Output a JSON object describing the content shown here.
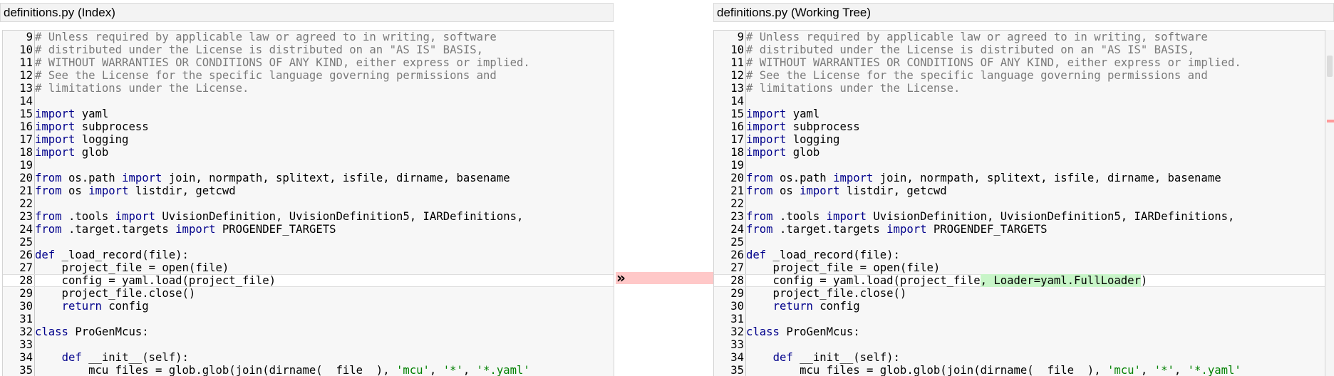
{
  "left_pane": {
    "title": "definitions.py (Index)",
    "lines": [
      {
        "n": "9",
        "s": [
          [
            "cm",
            "# Unless required by applicable law or agreed to in writing, software"
          ]
        ]
      },
      {
        "n": "10",
        "s": [
          [
            "cm",
            "# distributed under the License is distributed on an \"AS IS\" BASIS,"
          ]
        ]
      },
      {
        "n": "11",
        "s": [
          [
            "cm",
            "# WITHOUT WARRANTIES OR CONDITIONS OF ANY KIND, either express or implied."
          ]
        ]
      },
      {
        "n": "12",
        "s": [
          [
            "cm",
            "# See the License for the specific language governing permissions and"
          ]
        ]
      },
      {
        "n": "13",
        "s": [
          [
            "cm",
            "# limitations under the License."
          ]
        ]
      },
      {
        "n": "14",
        "s": []
      },
      {
        "n": "15",
        "s": [
          [
            "kw",
            "import"
          ],
          [
            "p",
            " yaml"
          ]
        ]
      },
      {
        "n": "16",
        "s": [
          [
            "kw",
            "import"
          ],
          [
            "p",
            " subprocess"
          ]
        ]
      },
      {
        "n": "17",
        "s": [
          [
            "kw",
            "import"
          ],
          [
            "p",
            " logging"
          ]
        ]
      },
      {
        "n": "18",
        "s": [
          [
            "kw",
            "import"
          ],
          [
            "p",
            " glob"
          ]
        ]
      },
      {
        "n": "19",
        "s": []
      },
      {
        "n": "20",
        "s": [
          [
            "kw",
            "from"
          ],
          [
            "p",
            " os.path "
          ],
          [
            "kw",
            "import"
          ],
          [
            "p",
            " join, normpath, splitext, isfile, dirname, basename"
          ]
        ]
      },
      {
        "n": "21",
        "s": [
          [
            "kw",
            "from"
          ],
          [
            "p",
            " os "
          ],
          [
            "kw",
            "import"
          ],
          [
            "p",
            " listdir, getcwd"
          ]
        ]
      },
      {
        "n": "22",
        "s": []
      },
      {
        "n": "23",
        "s": [
          [
            "kw",
            "from"
          ],
          [
            "p",
            " .tools "
          ],
          [
            "kw",
            "import"
          ],
          [
            "p",
            " UvisionDefinition, UvisionDefinition5, IARDefinitions,"
          ]
        ]
      },
      {
        "n": "24",
        "s": [
          [
            "kw",
            "from"
          ],
          [
            "p",
            " .target.targets "
          ],
          [
            "kw",
            "import"
          ],
          [
            "p",
            " PROGENDEF_TARGETS"
          ]
        ]
      },
      {
        "n": "25",
        "s": []
      },
      {
        "n": "26",
        "s": [
          [
            "kw",
            "def"
          ],
          [
            "p",
            " _load_record(file):"
          ]
        ]
      },
      {
        "n": "27",
        "s": [
          [
            "p",
            "    project_file = open(file)"
          ]
        ]
      },
      {
        "n": "28",
        "changed": true,
        "s": [
          [
            "p",
            "    config = yaml.load(project_file)"
          ]
        ]
      },
      {
        "n": "29",
        "s": [
          [
            "p",
            "    project_file.close()"
          ]
        ]
      },
      {
        "n": "30",
        "s": [
          [
            "p",
            "    "
          ],
          [
            "kw",
            "return"
          ],
          [
            "p",
            " config"
          ]
        ]
      },
      {
        "n": "31",
        "s": []
      },
      {
        "n": "32",
        "s": [
          [
            "kw",
            "class"
          ],
          [
            "p",
            " ProGenMcus:"
          ]
        ]
      },
      {
        "n": "33",
        "s": []
      },
      {
        "n": "34",
        "s": [
          [
            "p",
            "    "
          ],
          [
            "kw",
            "def"
          ],
          [
            "p",
            " __init__(self):"
          ]
        ]
      },
      {
        "n": "35",
        "s": [
          [
            "p",
            "        mcu_files = glob.glob(join(dirname(__file__), "
          ],
          [
            "str",
            "'mcu'"
          ],
          [
            "p",
            ", "
          ],
          [
            "str",
            "'*'"
          ],
          [
            "p",
            ", "
          ],
          [
            "str",
            "'*.yaml'"
          ]
        ]
      }
    ]
  },
  "right_pane": {
    "title": "definitions.py (Working Tree)",
    "lines": [
      {
        "n": "9",
        "s": [
          [
            "cm",
            "# Unless required by applicable law or agreed to in writing, software"
          ]
        ]
      },
      {
        "n": "10",
        "s": [
          [
            "cm",
            "# distributed under the License is distributed on an \"AS IS\" BASIS,"
          ]
        ]
      },
      {
        "n": "11",
        "s": [
          [
            "cm",
            "# WITHOUT WARRANTIES OR CONDITIONS OF ANY KIND, either express or implied."
          ]
        ]
      },
      {
        "n": "12",
        "s": [
          [
            "cm",
            "# See the License for the specific language governing permissions and"
          ]
        ]
      },
      {
        "n": "13",
        "s": [
          [
            "cm",
            "# limitations under the License."
          ]
        ]
      },
      {
        "n": "14",
        "s": []
      },
      {
        "n": "15",
        "s": [
          [
            "kw",
            "import"
          ],
          [
            "p",
            " yaml"
          ]
        ]
      },
      {
        "n": "16",
        "s": [
          [
            "kw",
            "import"
          ],
          [
            "p",
            " subprocess"
          ]
        ]
      },
      {
        "n": "17",
        "s": [
          [
            "kw",
            "import"
          ],
          [
            "p",
            " logging"
          ]
        ]
      },
      {
        "n": "18",
        "s": [
          [
            "kw",
            "import"
          ],
          [
            "p",
            " glob"
          ]
        ]
      },
      {
        "n": "19",
        "s": []
      },
      {
        "n": "20",
        "s": [
          [
            "kw",
            "from"
          ],
          [
            "p",
            " os.path "
          ],
          [
            "kw",
            "import"
          ],
          [
            "p",
            " join, normpath, splitext, isfile, dirname, basename"
          ]
        ]
      },
      {
        "n": "21",
        "s": [
          [
            "kw",
            "from"
          ],
          [
            "p",
            " os "
          ],
          [
            "kw",
            "import"
          ],
          [
            "p",
            " listdir, getcwd"
          ]
        ]
      },
      {
        "n": "22",
        "s": []
      },
      {
        "n": "23",
        "s": [
          [
            "kw",
            "from"
          ],
          [
            "p",
            " .tools "
          ],
          [
            "kw",
            "import"
          ],
          [
            "p",
            " UvisionDefinition, UvisionDefinition5, IARDefinitions,"
          ]
        ]
      },
      {
        "n": "24",
        "s": [
          [
            "kw",
            "from"
          ],
          [
            "p",
            " .target.targets "
          ],
          [
            "kw",
            "import"
          ],
          [
            "p",
            " PROGENDEF_TARGETS"
          ]
        ]
      },
      {
        "n": "25",
        "s": []
      },
      {
        "n": "26",
        "s": [
          [
            "kw",
            "def"
          ],
          [
            "p",
            " _load_record(file):"
          ]
        ]
      },
      {
        "n": "27",
        "s": [
          [
            "p",
            "    project_file = open(file)"
          ]
        ]
      },
      {
        "n": "28",
        "changed": true,
        "s": [
          [
            "p",
            "    config = yaml.load(project_file"
          ],
          [
            "add",
            ", Loader=yaml.FullLoader"
          ],
          [
            "p",
            ")"
          ]
        ]
      },
      {
        "n": "29",
        "s": [
          [
            "p",
            "    project_file.close()"
          ]
        ]
      },
      {
        "n": "30",
        "s": [
          [
            "p",
            "    "
          ],
          [
            "kw",
            "return"
          ],
          [
            "p",
            " config"
          ]
        ]
      },
      {
        "n": "31",
        "s": []
      },
      {
        "n": "32",
        "s": [
          [
            "kw",
            "class"
          ],
          [
            "p",
            " ProGenMcus:"
          ]
        ]
      },
      {
        "n": "33",
        "s": []
      },
      {
        "n": "34",
        "s": [
          [
            "p",
            "    "
          ],
          [
            "kw",
            "def"
          ],
          [
            "p",
            " __init__(self):"
          ]
        ]
      },
      {
        "n": "35",
        "s": [
          [
            "p",
            "        mcu_files = glob.glob(join(dirname(__file__), "
          ],
          [
            "str",
            "'mcu'"
          ],
          [
            "p",
            ", "
          ],
          [
            "str",
            "'*'"
          ],
          [
            "p",
            ", "
          ],
          [
            "str",
            "'*.yaml'"
          ]
        ]
      }
    ]
  },
  "merge": {
    "arrow_glyph": "»"
  },
  "colors": {
    "comment": "#7a7a7a",
    "keyword": "#00008b",
    "string": "#008000",
    "added_highlight": "#c8f5c8",
    "diff_band": "#ffc8c8",
    "gutter_bg": "#f7f7f7"
  }
}
